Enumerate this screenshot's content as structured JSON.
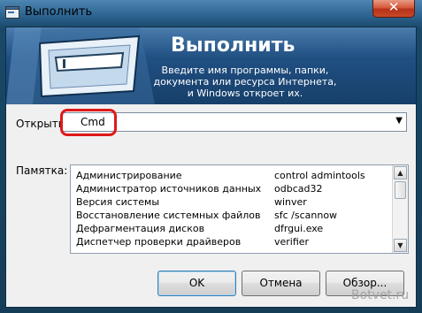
{
  "window": {
    "title": "Выполнить"
  },
  "banner": {
    "title": "Выполнить",
    "description_lines": [
      "Введите имя программы, папки,",
      "документа или ресурса Интернета,",
      "и Windows откроет их."
    ]
  },
  "open": {
    "label": "Открыть:",
    "value": "Cmd"
  },
  "memo": {
    "label": "Памятка:",
    "rows": [
      {
        "name": "Администрирование",
        "command": "control admintools"
      },
      {
        "name": "Администратор источников данных",
        "command": "odbcad32"
      },
      {
        "name": "Версия системы",
        "command": "winver"
      },
      {
        "name": "Восстановление системных файлов",
        "command": "sfc /scannow"
      },
      {
        "name": "Дефрагментация дисков",
        "command": "dfrgui.exe"
      },
      {
        "name": "Диспетчер проверки драйверов",
        "command": "verifier"
      }
    ]
  },
  "buttons": {
    "ok": "OK",
    "cancel": "Отмена",
    "browse": "Обзор..."
  },
  "watermark": "Botvet.ru",
  "colors": {
    "highlight": "#e01818",
    "banner": "#204f82",
    "close": "#c84a28"
  }
}
